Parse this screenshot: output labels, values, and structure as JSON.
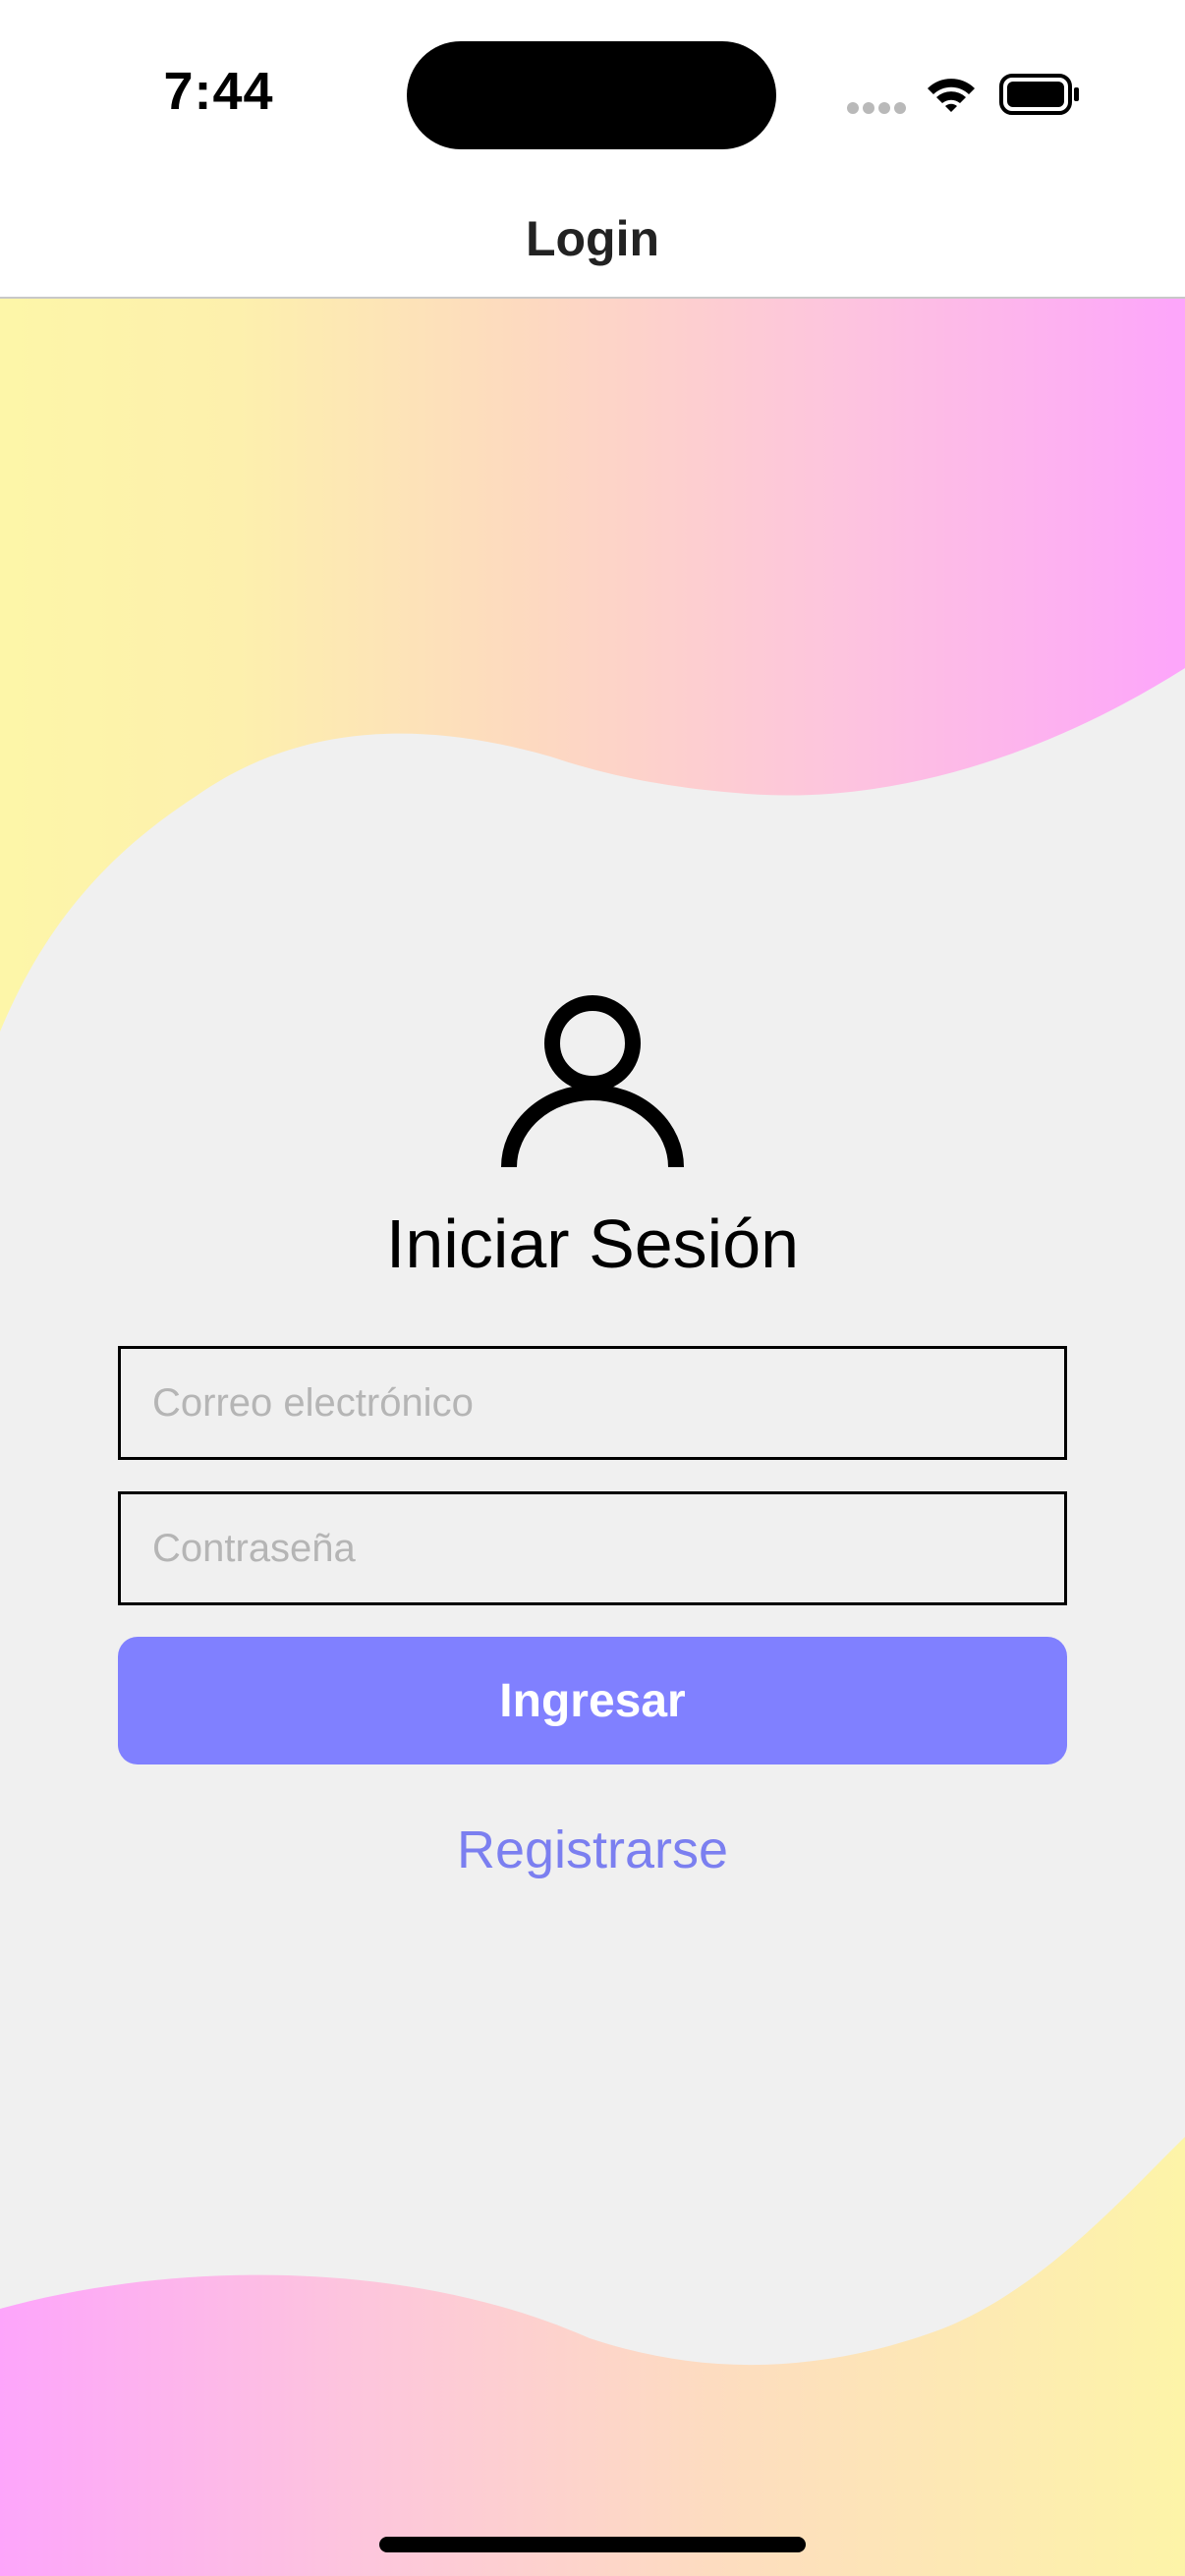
{
  "status_bar": {
    "time": "7:44"
  },
  "nav": {
    "title": "Login"
  },
  "login": {
    "heading": "Iniciar Sesión",
    "email_placeholder": "Correo electrónico",
    "email_value": "",
    "password_placeholder": "Contraseña",
    "password_value": "",
    "submit_label": "Ingresar",
    "register_label": "Registrarse"
  },
  "icons": {
    "user": "person-outline-icon",
    "wifi": "wifi-icon",
    "battery": "battery-icon",
    "signal": "cellular-signal-icon"
  },
  "colors": {
    "accent": "#8080ff",
    "link": "#7b7ff0",
    "background": "#f0f0f0",
    "gradient_yellow": "#fff5a8",
    "gradient_pink": "#fda5ff"
  }
}
